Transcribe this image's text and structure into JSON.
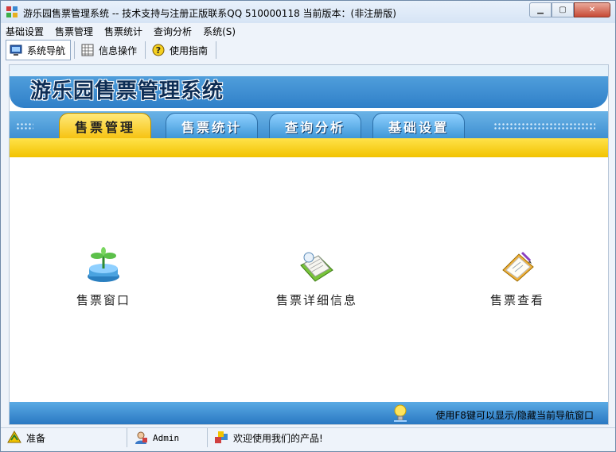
{
  "window": {
    "title": "游乐园售票管理系统 -- 技术支持与注册正版联系QQ 510000118    当前版本：(非注册版)",
    "minimize_icon": "minimize-icon",
    "maximize_icon": "maximize-icon",
    "close_icon": "close-icon"
  },
  "menubar": {
    "items": [
      "基础设置",
      "售票管理",
      "售票统计",
      "查询分析",
      "系统(S)"
    ]
  },
  "toolbar": {
    "items": [
      {
        "label": "系统导航",
        "icon": "monitor-icon"
      },
      {
        "label": "信息操作",
        "icon": "grid-icon"
      },
      {
        "label": "使用指南",
        "icon": "help-icon"
      }
    ]
  },
  "banner": {
    "title": "游乐园售票管理系统"
  },
  "tabs": {
    "items": [
      "售票管理",
      "售票统计",
      "查询分析",
      "基础设置"
    ],
    "active": "售票管理"
  },
  "main": {
    "cards": [
      {
        "label": "售票窗口",
        "icon": "plant-icon"
      },
      {
        "label": "售票详细信息",
        "icon": "notebook-icon"
      },
      {
        "label": "售票查看",
        "icon": "clipboard-icon"
      }
    ]
  },
  "footer": {
    "hint": "使用F8键可以显示/隐藏当前导航窗口",
    "icon": "lightbulb-icon"
  },
  "statusbar": {
    "ready": "准备",
    "user": "Admin",
    "message": "欢迎使用我们的产品!"
  },
  "colors": {
    "tab_active": "#f6c20f",
    "tab_inactive": "#3b95d6",
    "banner_blue": "#2f7fc8",
    "yellow_bar": "#f2c300"
  }
}
